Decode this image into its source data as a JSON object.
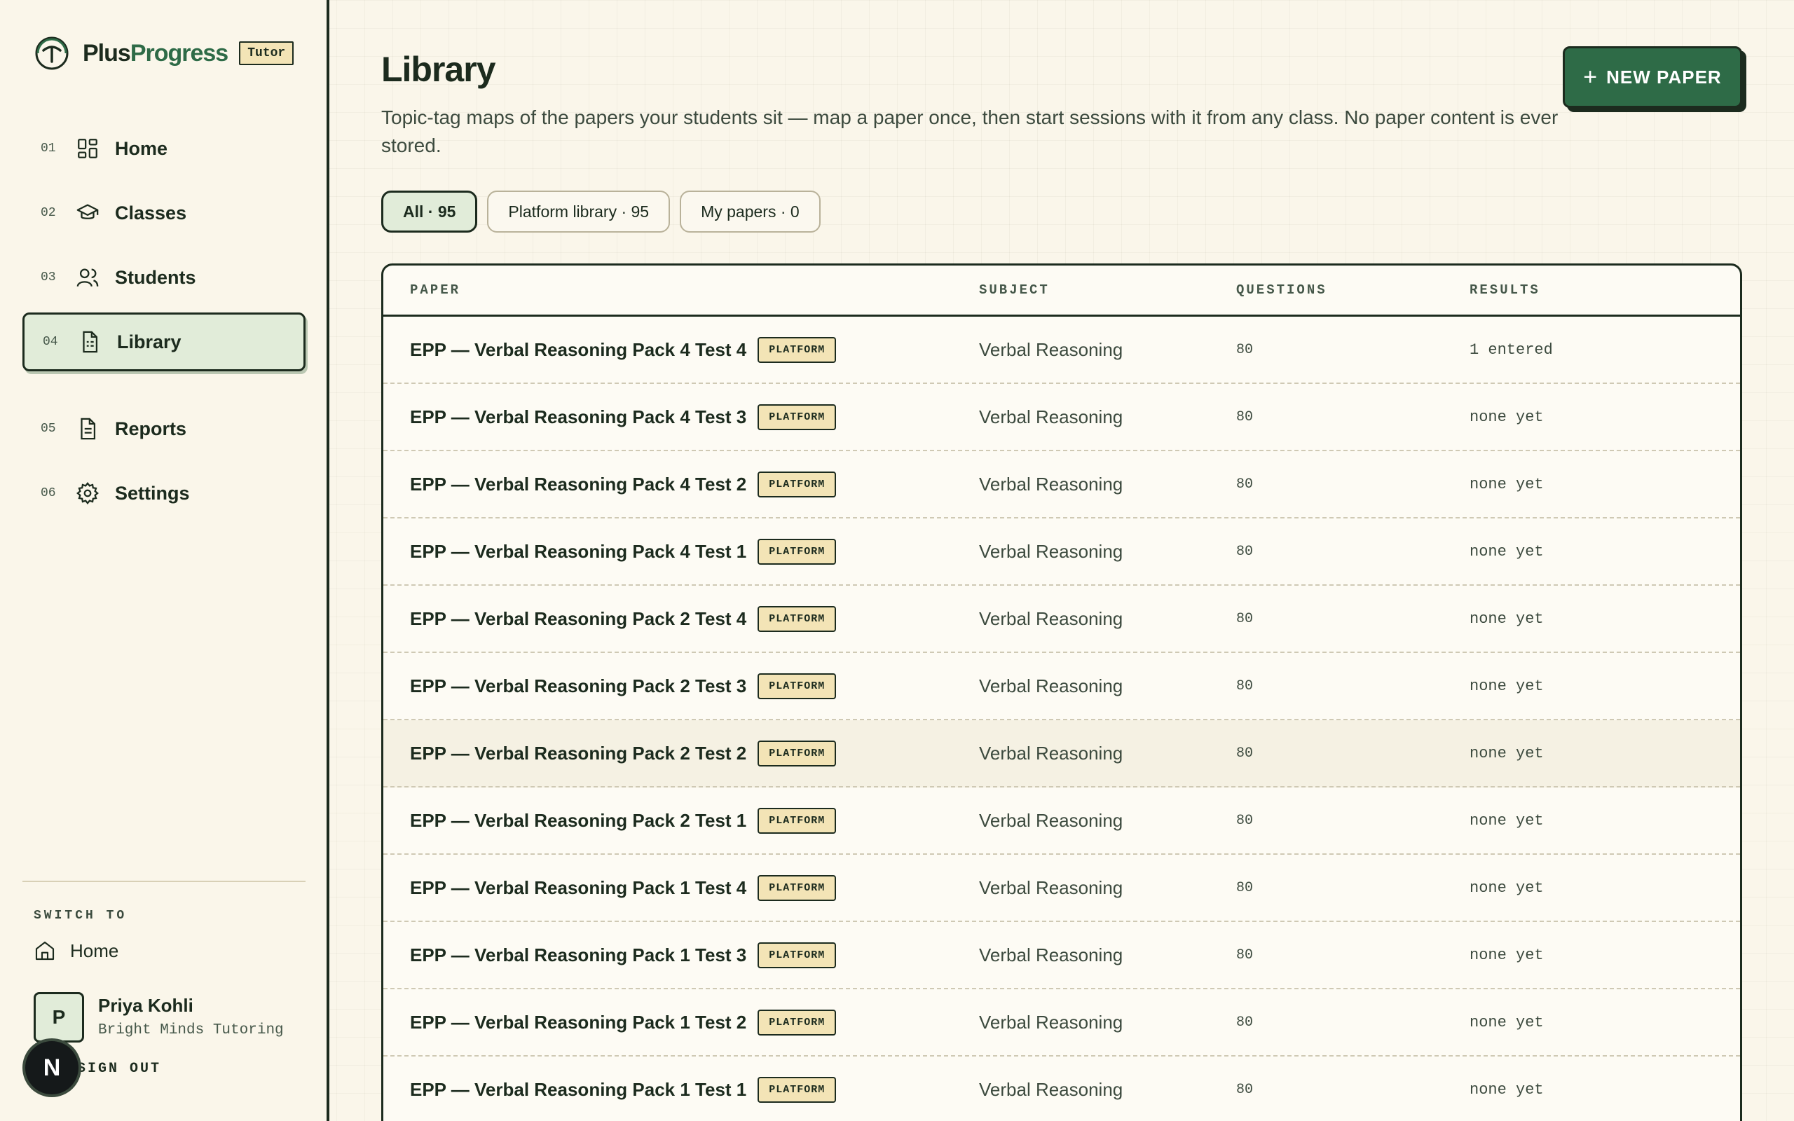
{
  "brand": {
    "name_part1": "Plus",
    "name_part2": "Progress",
    "role_badge": "Tutor"
  },
  "nav": {
    "items": [
      {
        "num": "01",
        "label": "Home",
        "icon": "grid-icon"
      },
      {
        "num": "02",
        "label": "Classes",
        "icon": "graduation-cap-icon"
      },
      {
        "num": "03",
        "label": "Students",
        "icon": "users-icon"
      },
      {
        "num": "04",
        "label": "Library",
        "icon": "document-icon",
        "active": true
      },
      {
        "num": "05",
        "label": "Reports",
        "icon": "report-icon"
      },
      {
        "num": "06",
        "label": "Settings",
        "icon": "gear-icon"
      }
    ]
  },
  "switch_to": {
    "title": "SWITCH TO",
    "home_label": "Home"
  },
  "user": {
    "initial": "P",
    "name": "Priya Kohli",
    "org": "Bright Minds Tutoring",
    "sign_out": "SIGN OUT"
  },
  "overlay": {
    "letter": "N"
  },
  "page": {
    "title": "Library",
    "description": "Topic-tag maps of the papers your students sit — map a paper once, then start sessions with it from any class. No paper content is ever stored.",
    "new_button": "NEW PAPER"
  },
  "filters": [
    {
      "label": "All · 95",
      "active": true
    },
    {
      "label": "Platform library · 95"
    },
    {
      "label": "My papers · 0"
    }
  ],
  "table": {
    "headers": {
      "paper": "PAPER",
      "subject": "SUBJECT",
      "questions": "QUESTIONS",
      "results": "RESULTS"
    },
    "rows": [
      {
        "paper": "EPP — Verbal Reasoning Pack 4 Test 4",
        "badge": "PLATFORM",
        "subject": "Verbal Reasoning",
        "questions": "80",
        "results": "1 entered"
      },
      {
        "paper": "EPP — Verbal Reasoning Pack 4 Test 3",
        "badge": "PLATFORM",
        "subject": "Verbal Reasoning",
        "questions": "80",
        "results": "none yet"
      },
      {
        "paper": "EPP — Verbal Reasoning Pack 4 Test 2",
        "badge": "PLATFORM",
        "subject": "Verbal Reasoning",
        "questions": "80",
        "results": "none yet"
      },
      {
        "paper": "EPP — Verbal Reasoning Pack 4 Test 1",
        "badge": "PLATFORM",
        "subject": "Verbal Reasoning",
        "questions": "80",
        "results": "none yet"
      },
      {
        "paper": "EPP — Verbal Reasoning Pack 2 Test 4",
        "badge": "PLATFORM",
        "subject": "Verbal Reasoning",
        "questions": "80",
        "results": "none yet"
      },
      {
        "paper": "EPP — Verbal Reasoning Pack 2 Test 3",
        "badge": "PLATFORM",
        "subject": "Verbal Reasoning",
        "questions": "80",
        "results": "none yet"
      },
      {
        "paper": "EPP — Verbal Reasoning Pack 2 Test 2",
        "badge": "PLATFORM",
        "subject": "Verbal Reasoning",
        "questions": "80",
        "results": "none yet"
      },
      {
        "paper": "EPP — Verbal Reasoning Pack 2 Test 1",
        "badge": "PLATFORM",
        "subject": "Verbal Reasoning",
        "questions": "80",
        "results": "none yet"
      },
      {
        "paper": "EPP — Verbal Reasoning Pack 1 Test 4",
        "badge": "PLATFORM",
        "subject": "Verbal Reasoning",
        "questions": "80",
        "results": "none yet"
      },
      {
        "paper": "EPP — Verbal Reasoning Pack 1 Test 3",
        "badge": "PLATFORM",
        "subject": "Verbal Reasoning",
        "questions": "80",
        "results": "none yet"
      },
      {
        "paper": "EPP — Verbal Reasoning Pack 1 Test 2",
        "badge": "PLATFORM",
        "subject": "Verbal Reasoning",
        "questions": "80",
        "results": "none yet"
      },
      {
        "paper": "EPP — Verbal Reasoning Pack 1 Test 1",
        "badge": "PLATFORM",
        "subject": "Verbal Reasoning",
        "questions": "80",
        "results": "none yet"
      }
    ]
  },
  "colors": {
    "accent": "#2e6b47",
    "ink": "#1c2b1e",
    "badge": "#f3e4b6",
    "active_bg": "#e1ecd9",
    "page_bg": "#faf6ea"
  }
}
